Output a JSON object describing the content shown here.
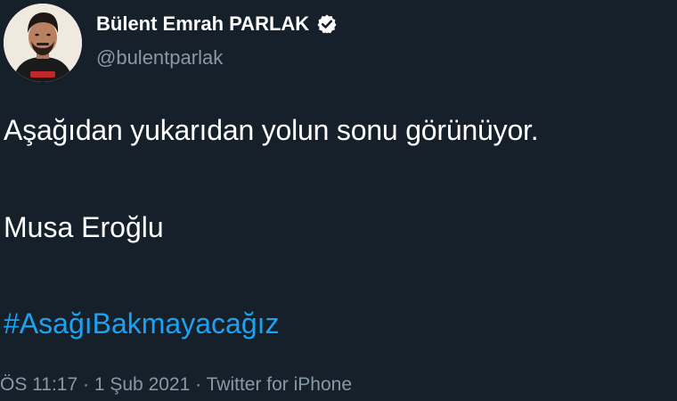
{
  "author": {
    "display_name": "Bülent Emrah PARLAK",
    "handle": "@bulentparlak",
    "verified": true,
    "verified_icon": "verified-badge-icon"
  },
  "tweet": {
    "line1": "Aşağıdan yukarıdan yolun sonu görünüyor.",
    "line2": "Musa Eroğlu",
    "hashtag": "#AsağıBakmayacağız"
  },
  "meta": {
    "time": "ÖS 11:17",
    "separator1": "·",
    "date": "1 Şub 2021",
    "separator2": "·",
    "source": "Twitter for iPhone"
  },
  "colors": {
    "background": "#15202b",
    "text": "#ffffff",
    "secondary_text": "#8899a6",
    "link": "#1da1f2"
  }
}
